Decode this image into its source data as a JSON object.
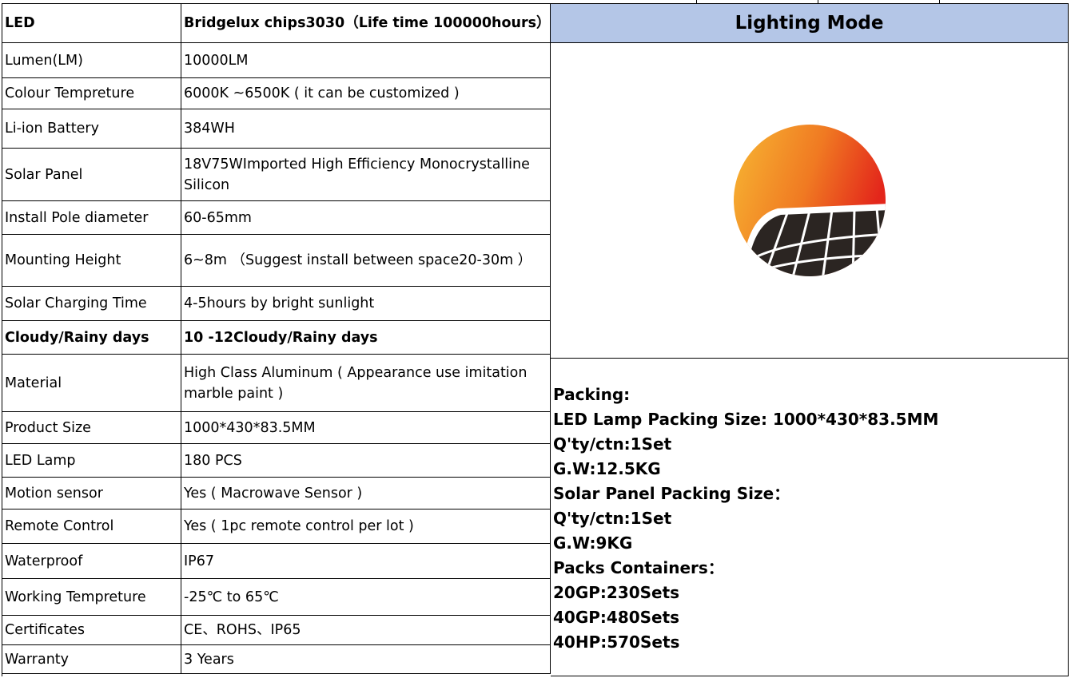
{
  "specs": [
    {
      "label": "LED",
      "value": "Bridgelux chips3030（Life time 100000hours）",
      "bold": true
    },
    {
      "label": "Lumen(LM)",
      "value": "10000LM"
    },
    {
      "label": "Colour Tempreture",
      "value": "6000K ~6500K ( it can be customized )"
    },
    {
      "label": "Li-ion Battery",
      "value": "384WH"
    },
    {
      "label": "Solar Panel",
      "value": "18V75WImported High Efficiency Monocrystalline Silicon"
    },
    {
      "label": "Install Pole diameter",
      "value": "60-65mm"
    },
    {
      "label": "Mounting Height",
      "value": "6~8m （Suggest install between space20-30m ）"
    },
    {
      "label": "Solar Charging Time",
      "value": "4-5hours by bright sunlight"
    },
    {
      "label": "Cloudy/Rainy days",
      "value": "10 -12Cloudy/Rainy days",
      "bold": true
    },
    {
      "label": "Material",
      "value": "High Class Aluminum ( Appearance use imitation marble paint )"
    },
    {
      "label": "Product Size",
      "value": "1000*430*83.5MM"
    },
    {
      "label": "LED Lamp",
      "value": "180 PCS"
    },
    {
      "label": "Motion sensor",
      "value": "Yes ( Macrowave Sensor )"
    },
    {
      "label": "Remote Control",
      "value": "Yes ( 1pc remote control per lot )"
    },
    {
      "label": "Waterproof",
      "value": "IP67"
    },
    {
      "label": "Working Tempreture",
      "value": "-25℃ to 65℃"
    },
    {
      "label": "Certificates",
      "value": "CE、ROHS、IP65"
    },
    {
      "label": "Warranty",
      "value": "3 Years"
    }
  ],
  "lighting_mode": {
    "title": "Lighting Mode"
  },
  "packing": [
    "Packing:",
    "LED Lamp Packing Size: 1000*430*83.5MM",
    "Q'ty/ctn:1Set",
    "G.W:12.5KG",
    "Solar Panel Packing Size：",
    "Q'ty/ctn:1Set",
    "G.W:9KG",
    "Packs Containers：",
    "20GP:230Sets",
    "40GP:480Sets",
    "40HP:570Sets"
  ],
  "colors": {
    "header_bg": "#b4c6e7",
    "sun_top": "#f6a623",
    "sun_right": "#e8331c",
    "panel": "#2b2522"
  },
  "icons": {
    "logo": "solar-sun-logo-icon"
  }
}
